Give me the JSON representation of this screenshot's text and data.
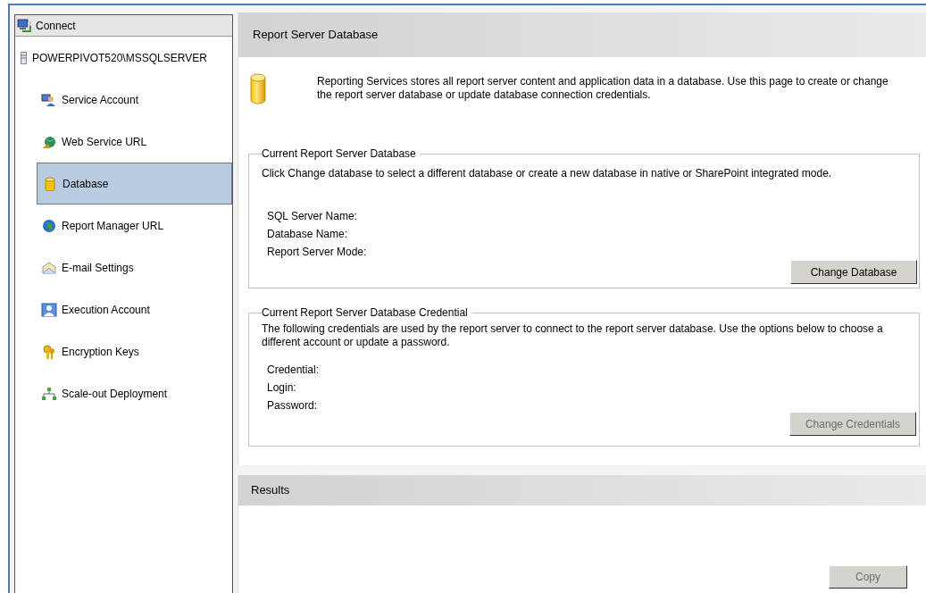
{
  "sidebar": {
    "header": "Connect",
    "server": "POWERPIVOT520\\MSSQLSERVER",
    "items": [
      {
        "label": "Service Account",
        "kind": "account",
        "selected": false
      },
      {
        "label": "Web Service URL",
        "kind": "web",
        "selected": false
      },
      {
        "label": "Database",
        "kind": "database",
        "selected": true
      },
      {
        "label": "Report Manager URL",
        "kind": "globe",
        "selected": false
      },
      {
        "label": "E-mail Settings",
        "kind": "mail",
        "selected": false
      },
      {
        "label": "Execution Account",
        "kind": "user",
        "selected": false
      },
      {
        "label": "Encryption Keys",
        "kind": "keys",
        "selected": false
      },
      {
        "label": "Scale-out Deployment",
        "kind": "network",
        "selected": false
      }
    ]
  },
  "main": {
    "title": "Report Server Database",
    "intro": "Reporting Services stores all report server content and application data in a database. Use this page to create or change the report server database or update database connection credentials.",
    "groups": [
      {
        "legend": "Current Report Server Database",
        "description": "Click Change database to select a different database or create a new database in native or SharePoint integrated mode.",
        "fields": [
          "SQL Server Name:",
          "Database Name:",
          "Report Server Mode:"
        ],
        "button": {
          "label": "Change Database",
          "disabled": false
        }
      },
      {
        "legend": "Current Report Server Database Credential",
        "description": "The following credentials are used by the report server to connect to the report server database.  Use the options below to choose a different account or update a password.",
        "fields": [
          "Credential:",
          "Login:",
          "Password:"
        ],
        "button": {
          "label": "Change Credentials",
          "disabled": true
        }
      }
    ]
  },
  "results": {
    "title": "Results",
    "button": {
      "label": "Copy",
      "disabled": true
    }
  }
}
